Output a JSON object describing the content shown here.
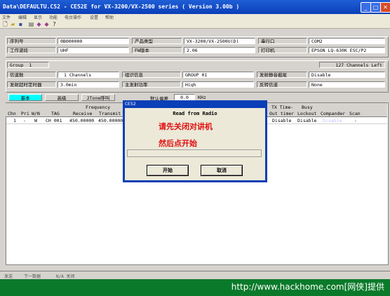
{
  "window": {
    "title": "Data\\DEFAULTU.C52 - CE52E for VX-3200/VX-2500 series ( Version 3.00b )"
  },
  "menu": [
    "文件",
    "编辑",
    "显示",
    "功能",
    "电台操作",
    "设置",
    "帮助"
  ],
  "info": {
    "serial_label": "序列号",
    "serial_value": "0B000000",
    "product_label": "产品类型",
    "product_value": "VX-3200/VX-2500U(D)",
    "port_label": "串行口",
    "port_value": "COM2",
    "band_label": "工作波段",
    "band_value": "UHF",
    "fw_label": "FW版本",
    "fw_value": "2.06",
    "printer_label": "打印机",
    "printer_value": "EPSON LQ-630K ESC/P2"
  },
  "group": {
    "label": "Group",
    "number": "1",
    "channels_left": "127  Channels Left",
    "ch_count_label": "信道数",
    "ch_count_value": "1  Channels",
    "id_label": "组识信息",
    "id_value": "GROUP 01",
    "mute_label": "发射静音截尾",
    "mute_value": "Disable",
    "tot_label": "发射超时定时器",
    "tot_value": "3.0min",
    "power_label": "主发射功率",
    "power_value": "High",
    "scan_label": "反转信道",
    "scan_value": "None"
  },
  "tabs": [
    "基本",
    "高级",
    "2Tone呼叫"
  ],
  "offset": {
    "label": "默认偏差",
    "value": "0.0",
    "unit": "KHz"
  },
  "table": {
    "h_freq": "Frequency",
    "h_chn": "Chn",
    "h_pri": "Pri",
    "h_wn": "W/N",
    "h_tag": "TAG",
    "h_rx": "Receive",
    "h_tx": "Transmit",
    "h_tx_time": "TX Time-",
    "h_out_timer": "Out timer",
    "h_busy": "Busy",
    "h_lockout": "Lockout",
    "h_compander": "Compander",
    "h_scan": "Scan",
    "row": {
      "chn": "1",
      "pri": "-",
      "wn": "W",
      "tag": "CH 001",
      "rx": "450.00000",
      "tx": "450.00000",
      "tot": "Disable",
      "lockout": "Disable",
      "compander": "Disable",
      "scan": "-"
    }
  },
  "status": [
    "发送",
    "下一数据",
    "N/A 关闭"
  ],
  "watermark": "http://www.hackhome.com[网侠]提供",
  "dialog": {
    "title": "CE52",
    "heading": "Read from Radio",
    "line1": "请先关闭对讲机",
    "line2": "然后点开始",
    "start": "开始",
    "cancel": "取消",
    "progress": 0
  }
}
